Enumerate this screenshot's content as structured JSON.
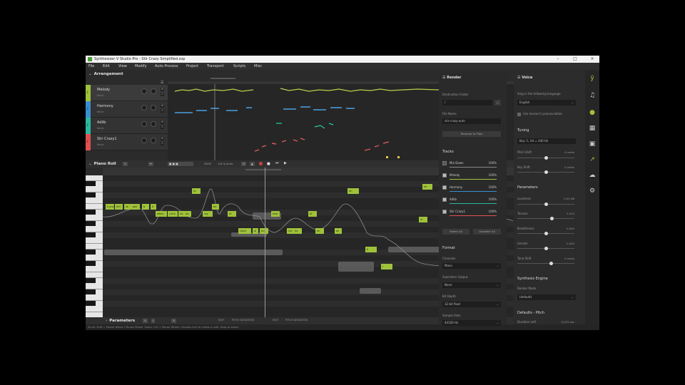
{
  "window": {
    "title": "Synthesizer V Studio Pro - Stir Crazy Simplified.svp"
  },
  "menu": [
    "File",
    "Edit",
    "View",
    "Modify",
    "Auto-Process",
    "Project",
    "Transport",
    "Scripts",
    "Misc"
  ],
  "arrangement": {
    "title": "Arrangement",
    "tracks": [
      {
        "name": "Melody",
        "sub": "Kevin",
        "color": "#9fc23a"
      },
      {
        "name": "Harmony",
        "sub": "Kevin",
        "color": "#3a8fd0"
      },
      {
        "name": "Adlib",
        "sub": "Kevin",
        "color": "#2ab8a0"
      },
      {
        "name": "Stir Crazy1",
        "sub": "Kevin",
        "color": "#e05050"
      }
    ]
  },
  "pianoroll": {
    "title": "Piano Roll",
    "quantize": "1/8 Quarter",
    "snap": "SNAP",
    "notes": [
      {
        "lyric": "k pnw"
      },
      {
        "lyric": "hm"
      },
      {
        "lyric": "iw"
      },
      {
        "lyric": "ppt"
      },
      {
        "lyric": "b"
      },
      {
        "lyric": "d"
      },
      {
        "lyric": "when"
      },
      {
        "lyric": "y'are"
      },
      {
        "lyric": "ha"
      },
      {
        "lyric": "aa"
      },
      {
        "lyric": "tv"
      },
      {
        "lyric": "ing"
      },
      {
        "lyric": "ha"
      },
      {
        "lyric": "of"
      },
      {
        "lyric": "clock"
      },
      {
        "lyric": "ai"
      },
      {
        "lyric": "om"
      },
      {
        "lyric": "teet"
      },
      {
        "lyric": "ing"
      },
      {
        "lyric": "ha"
      },
      {
        "lyric": "of"
      },
      {
        "lyric": "ah"
      },
      {
        "lyric": "ok"
      },
      {
        "lyric": "ah"
      },
      {
        "lyric": "b"
      },
      {
        "lyric": "i"
      },
      {
        "lyric": "sl"
      },
      {
        "lyric": "ah"
      },
      {
        "lyric": "pfi"
      },
      {
        "lyric": "a"
      },
      {
        "lyric": "ah"
      }
    ]
  },
  "params": {
    "title": "Parameters",
    "labels": [
      "EDIT",
      "PITCH DEVIATION",
      "EDIT",
      "PITCH DEVIATION"
    ]
  },
  "status": "Scroll: Shift + Mouse Wheel / Mouse Wheel, Zoom: Ctrl + Mouse Wheel / Double-click to create a note, Drag to select.",
  "render": {
    "title": "Render",
    "dest_label": "Destination Folder",
    "dest_value": "/",
    "file_label": "File Name",
    "file_value": "stir-crazy-auto",
    "reveal_button": "Rename to Files",
    "tracks_label": "Tracks",
    "track_rows": [
      {
        "name": "Mix Down",
        "pct": "100%",
        "color": "#888888"
      },
      {
        "name": "Melody",
        "pct": "100%",
        "color": "#9fc23a"
      },
      {
        "name": "Harmony",
        "pct": "100%",
        "color": "#3a8fd0"
      },
      {
        "name": "Adlib",
        "pct": "100%",
        "color": "#2ab8a0"
      },
      {
        "name": "Stir Crazy1",
        "pct": "100%",
        "color": "#e05050"
      }
    ],
    "select_all": "Select All",
    "unselect_all": "Unselect All",
    "format_label": "Format",
    "channels_label": "Channels",
    "channels_value": "Mono",
    "aspiration_label": "Aspiration Output",
    "aspiration_value": "None",
    "bitdepth_label": "Bit Depth",
    "bitdepth_value": "32-bit float",
    "samplerate_label": "Sample Rate",
    "samplerate_value": "44100 Hz"
  },
  "voice": {
    "title": "Voice",
    "sing_label": "Sing in the following language",
    "language": "English",
    "lexicon": "Use lexicon's pronunciation",
    "tuning_label": "Tuning",
    "key_value": "Key: C, A4 = 440 Hz",
    "pitch_shift_label": "Pitch Shift",
    "pitch_shift_val": "0 cents",
    "key_shift_label": "Key Shift",
    "key_shift_val": "0 cents",
    "parameters_label": "Parameters",
    "loudness_label": "Loudness",
    "loudness_val": "0.00 dB",
    "tension_label": "Tension",
    "tension_val": "0.225",
    "breathiness_label": "Breathiness",
    "breathiness_val": "0.000",
    "gender_label": "Gender",
    "gender_val": "0.000",
    "toneshift_label": "Tone Shift",
    "toneshift_val": "0 cents",
    "engine_label": "Synthesis Engine",
    "render_mode_label": "Render Mode",
    "render_mode_value": "(default)",
    "defaults_label": "Defaults - Pitch",
    "duration_label": "Duration Left",
    "duration_val": "0.075 sec"
  }
}
